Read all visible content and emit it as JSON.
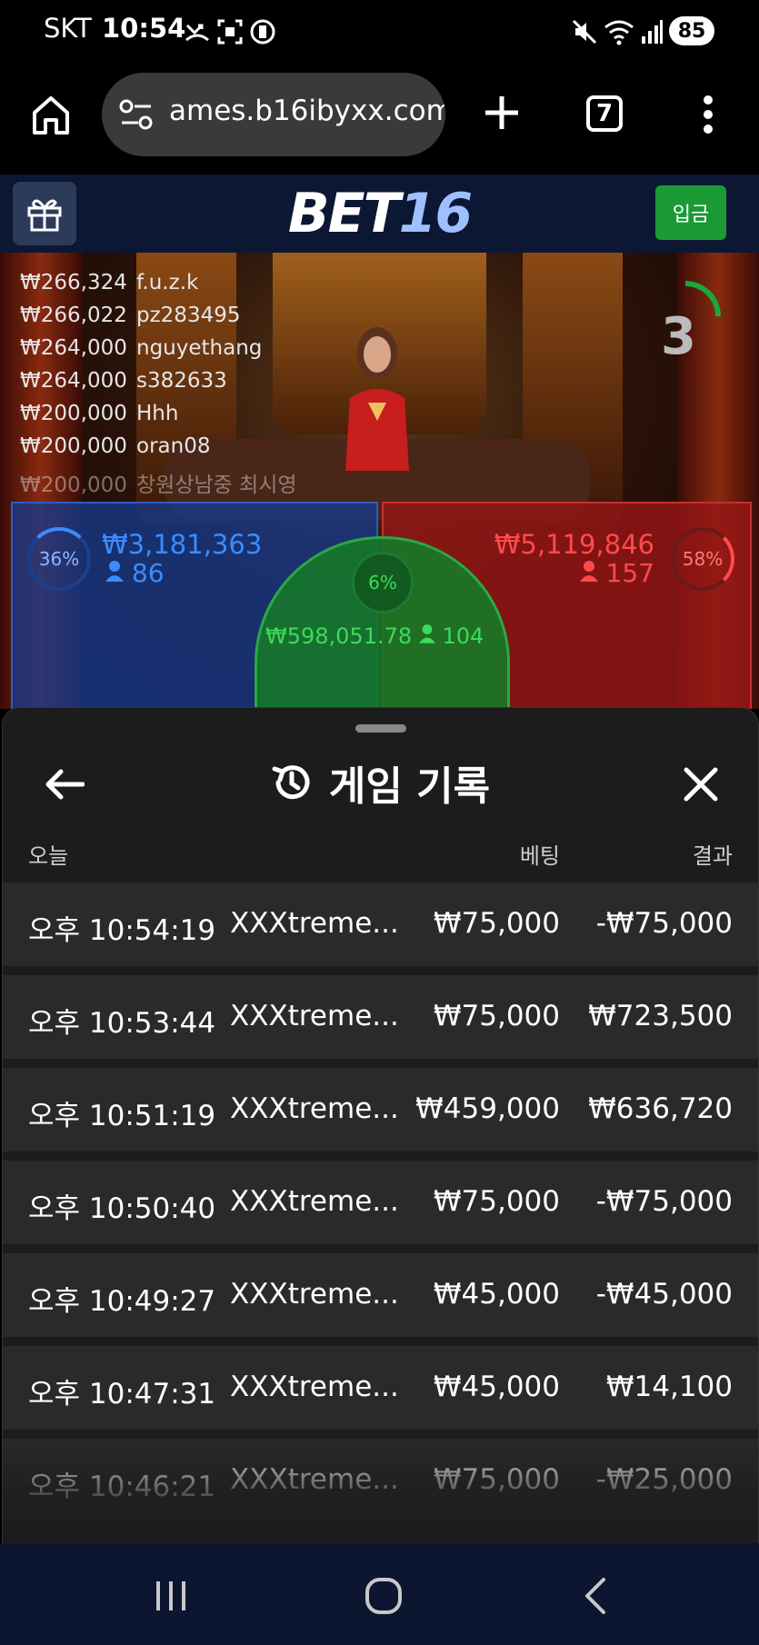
{
  "status_bar": {
    "carrier": "SKT",
    "time": "10:54",
    "battery": "85"
  },
  "browser": {
    "url": "ames.b16ibyxx.com",
    "tab_count": "7"
  },
  "site": {
    "logo_part1": "BET",
    "logo_part2": "16",
    "deposit_label": "입금"
  },
  "game": {
    "countdown": "3",
    "recent_bets": [
      {
        "amount": "₩266,324",
        "user": "f.u.z.k"
      },
      {
        "amount": "₩266,022",
        "user": "pz283495"
      },
      {
        "amount": "₩264,000",
        "user": "nguyethang"
      },
      {
        "amount": "₩264,000",
        "user": "s382633"
      },
      {
        "amount": "₩200,000",
        "user": "Hhh"
      },
      {
        "amount": "₩200,000",
        "user": "oran08"
      },
      {
        "amount": "₩200,000",
        "user": "창원상남중 최시영"
      }
    ],
    "player": {
      "percent": "36%",
      "amount": "₩3,181,363",
      "count": "86",
      "color": "#1f55c8"
    },
    "banker": {
      "percent": "58%",
      "amount": "₩5,119,846",
      "count": "157",
      "color": "#c42b2b"
    },
    "tie": {
      "percent": "6%",
      "amount": "₩598,051.78",
      "count": "104",
      "color": "#1aa83a"
    }
  },
  "history": {
    "title": "게임 기록",
    "columns": {
      "date": "오늘",
      "bet": "베팅",
      "result": "결과"
    },
    "rows": [
      {
        "time": "오후 10:54:19",
        "game": "XXXtreme...",
        "bet": "₩75,000",
        "result": "-₩75,000"
      },
      {
        "time": "오후 10:53:44",
        "game": "XXXtreme...",
        "bet": "₩75,000",
        "result": "₩723,500"
      },
      {
        "time": "오후 10:51:19",
        "game": "XXXtreme...",
        "bet": "₩459,000",
        "result": "₩636,720"
      },
      {
        "time": "오후 10:50:40",
        "game": "XXXtreme...",
        "bet": "₩75,000",
        "result": "-₩75,000"
      },
      {
        "time": "오후 10:49:27",
        "game": "XXXtreme...",
        "bet": "₩45,000",
        "result": "-₩45,000"
      },
      {
        "time": "오후 10:47:31",
        "game": "XXXtreme...",
        "bet": "₩45,000",
        "result": "₩14,100"
      },
      {
        "time": "오후 10:46:21",
        "game": "XXXtreme...",
        "bet": "₩75,000",
        "result": "-₩25,000"
      }
    ]
  }
}
